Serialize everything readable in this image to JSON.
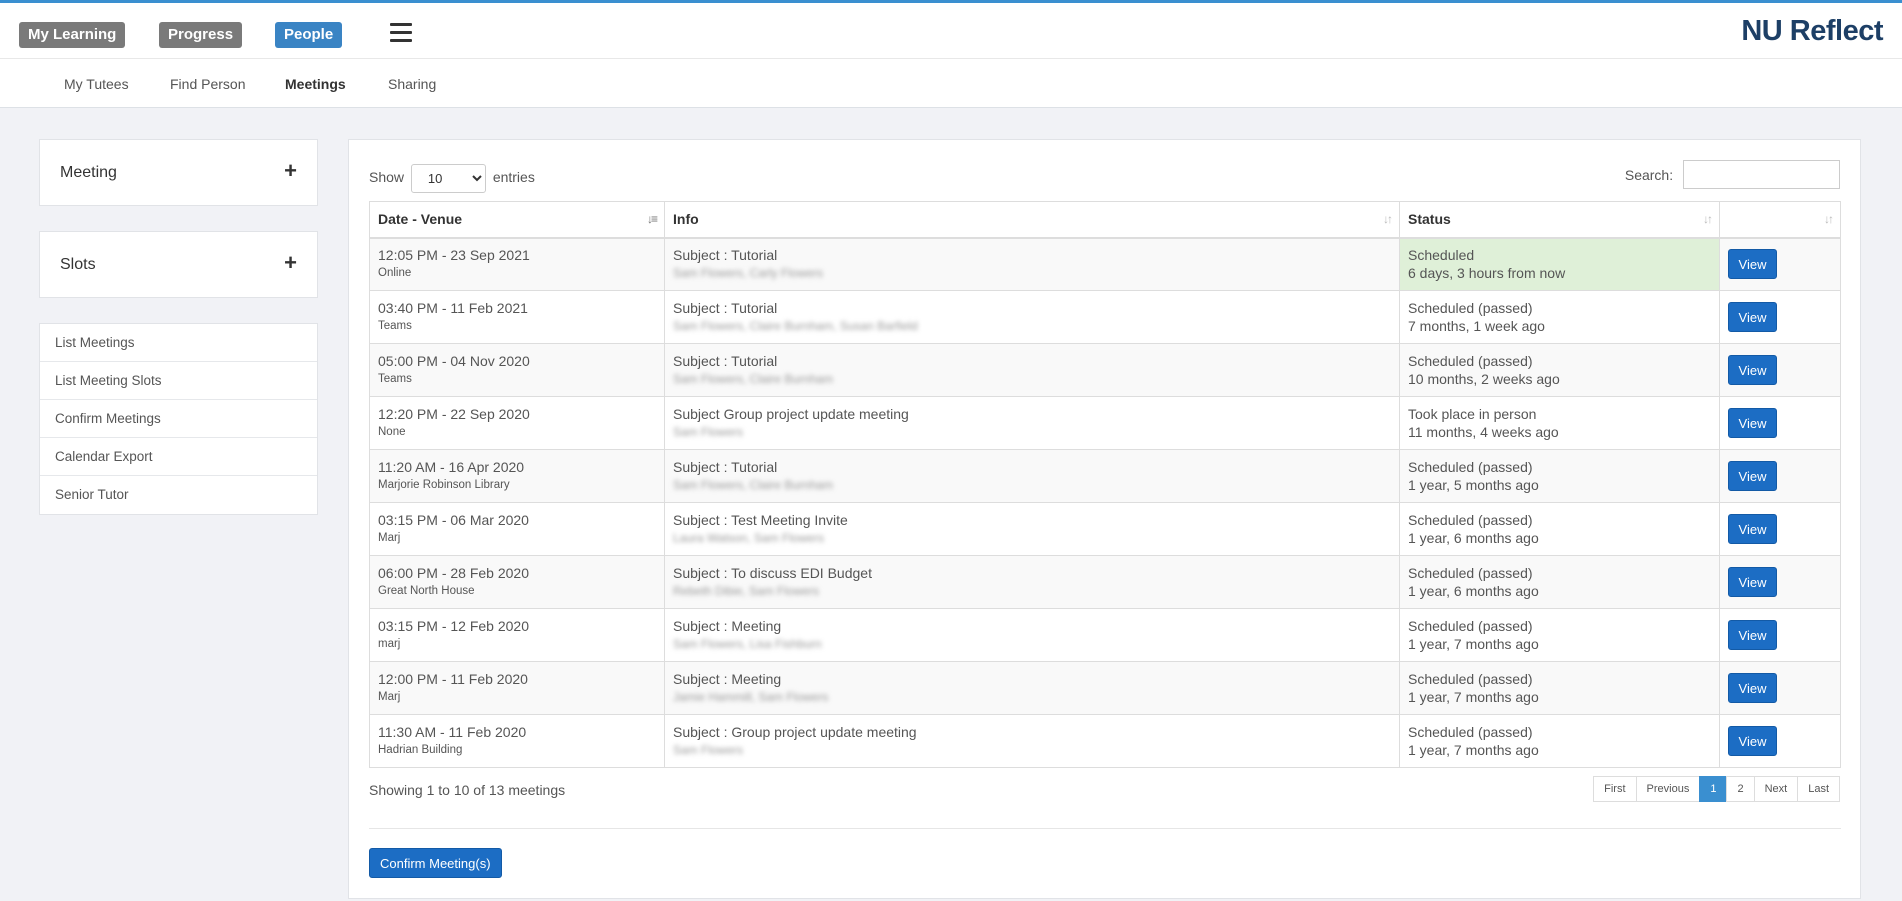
{
  "topnav": {
    "my_learning": "My Learning",
    "progress": "Progress",
    "people": "People",
    "brand": "NU Reflect"
  },
  "subnav": {
    "my_tutees": "My Tutees",
    "find_person": "Find Person",
    "meetings": "Meetings",
    "sharing": "Sharing"
  },
  "sidebar": {
    "meeting": "Meeting",
    "slots": "Slots",
    "plus": "+",
    "items": [
      "List Meetings",
      "List Meeting Slots",
      "Confirm Meetings",
      "Calendar Export",
      "Senior Tutor"
    ]
  },
  "controls": {
    "show_label": "Show",
    "entries_value": "10",
    "entries_label": "entries",
    "search_label": "Search:"
  },
  "table": {
    "headers": [
      "Date - Venue",
      "Info",
      "Status",
      ""
    ],
    "rows": [
      {
        "date": "12:05 PM - 23 Sep 2021",
        "venue": "Online",
        "subject": "Subject :  Tutorial",
        "people": "Sam Flowers, Carly Flowers",
        "status": "Scheduled",
        "when": "6 days, 3 hours from now",
        "view": "View"
      },
      {
        "date": "03:40 PM - 11 Feb 2021",
        "venue": "Teams",
        "subject": "Subject :  Tutorial",
        "people": "Sam Flowers, Claire Burnham, Susan Barfield",
        "status": "Scheduled (passed)",
        "when": "7 months, 1 week ago",
        "view": "View"
      },
      {
        "date": "05:00 PM - 04 Nov 2020",
        "venue": "Teams",
        "subject": "Subject : Tutorial",
        "people": "Sam Flowers, Claire Burnham",
        "status": "Scheduled (passed)",
        "when": "10 months, 2 weeks ago",
        "view": "View"
      },
      {
        "date": "12:20 PM - 22 Sep 2020",
        "venue": "None",
        "subject": "Subject Group project update meeting",
        "people": "Sam Flowers",
        "status": "Took place in person",
        "when": "11 months, 4 weeks ago",
        "view": "View"
      },
      {
        "date": "11:20 AM - 16 Apr 2020",
        "venue": "Marjorie Robinson Library",
        "subject": "Subject : Tutorial",
        "people": "Sam Flowers, Claire Burnham",
        "status": "Scheduled (passed)",
        "when": "1 year, 5 months ago",
        "view": "View"
      },
      {
        "date": "03:15 PM - 06 Mar 2020",
        "venue": "Marj",
        "subject": "Subject : Test Meeting Invite",
        "people": "Laura Watson, Sam Flowers",
        "status": "Scheduled (passed)",
        "when": "1 year, 6 months ago",
        "view": "View"
      },
      {
        "date": "06:00 PM - 28 Feb 2020",
        "venue": "Great North House",
        "subject": "Subject : To discuss EDI Budget",
        "people": "Rebeth Dibie, Sam Flowers",
        "status": "Scheduled (passed)",
        "when": "1 year, 6 months ago",
        "view": "View"
      },
      {
        "date": "03:15 PM - 12 Feb 2020",
        "venue": "marj",
        "subject": "Subject : Meeting",
        "people": "Sam Flowers, Lisa Fishburn",
        "status": "Scheduled (passed)",
        "when": "1 year, 7 months ago",
        "view": "View"
      },
      {
        "date": "12:00 PM - 11 Feb 2020",
        "venue": "Marj",
        "subject": "Subject : Meeting",
        "people": "Jamie Hammill, Sam Flowers",
        "status": "Scheduled (passed)",
        "when": "1 year, 7 months ago",
        "view": "View"
      },
      {
        "date": "11:30 AM - 11 Feb 2020",
        "venue": "Hadrian Building",
        "subject": "Subject : Group project update meeting",
        "people": "Sam Flowers",
        "status": "Scheduled (passed)",
        "when": "1 year, 7 months ago",
        "view": "View"
      }
    ]
  },
  "footer": {
    "showing": "Showing 1 to 10 of 13 meetings",
    "pager": [
      "First",
      "Previous",
      "1",
      "2",
      "Next",
      "Last"
    ],
    "confirm": "Confirm Meeting(s)"
  }
}
